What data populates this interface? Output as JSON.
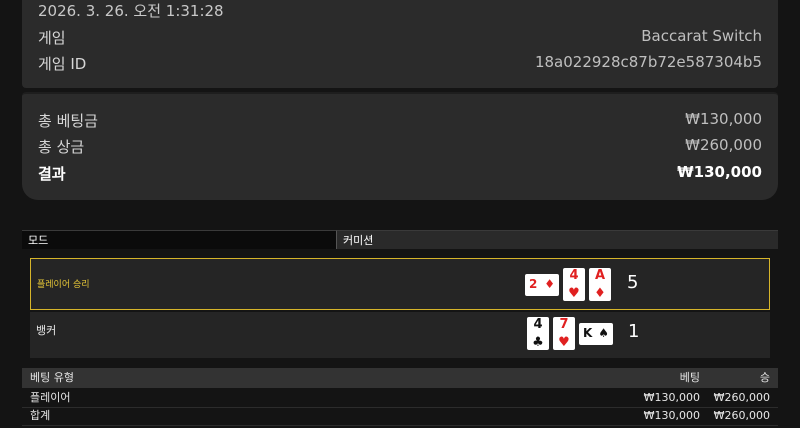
{
  "info": {
    "datetime": "2026. 3. 26. 오전 1:31:28",
    "game_label": "게임",
    "game_value": "Baccarat Switch",
    "game_id_label": "게임 ID",
    "game_id_value": "18a022928c87b72e587304b5"
  },
  "summary": {
    "total_bet_label": "총 베팅금",
    "total_bet_value": "₩130,000",
    "total_win_label": "총 상금",
    "total_win_value": "₩260,000",
    "result_label": "결과",
    "result_value": "₩130,000"
  },
  "mode_bar": {
    "mode_label": "모드",
    "commission_label": "커미션"
  },
  "hands": {
    "player": {
      "label": "플레이어 승리",
      "score": "5",
      "cards": [
        {
          "rank": "2",
          "suit": "♦",
          "color": "#e02020",
          "orientation": "sideways"
        },
        {
          "rank": "4",
          "suit": "♥",
          "color": "#e02020",
          "orientation": "upright"
        },
        {
          "rank": "A",
          "suit": "♦",
          "color": "#e02020",
          "orientation": "upright"
        }
      ]
    },
    "banker": {
      "label": "뱅커",
      "score": "1",
      "cards": [
        {
          "rank": "4",
          "suit": "♣",
          "color": "#111111",
          "orientation": "upright"
        },
        {
          "rank": "7",
          "suit": "♥",
          "color": "#e02020",
          "orientation": "upright"
        },
        {
          "rank": "K",
          "suit": "♠",
          "color": "#111111",
          "orientation": "sideways"
        }
      ]
    }
  },
  "bets_table": {
    "headers": [
      "베팅 유형",
      "베팅",
      "승"
    ],
    "rows": [
      [
        "플레이어",
        "₩130,000",
        "₩260,000"
      ],
      [
        "합계",
        "₩130,000",
        "₩260,000"
      ]
    ]
  },
  "colors": {
    "win_highlight": "#d6b52a",
    "card_red": "#e02020",
    "background": "#141414",
    "panel": "#2b2b2b"
  }
}
